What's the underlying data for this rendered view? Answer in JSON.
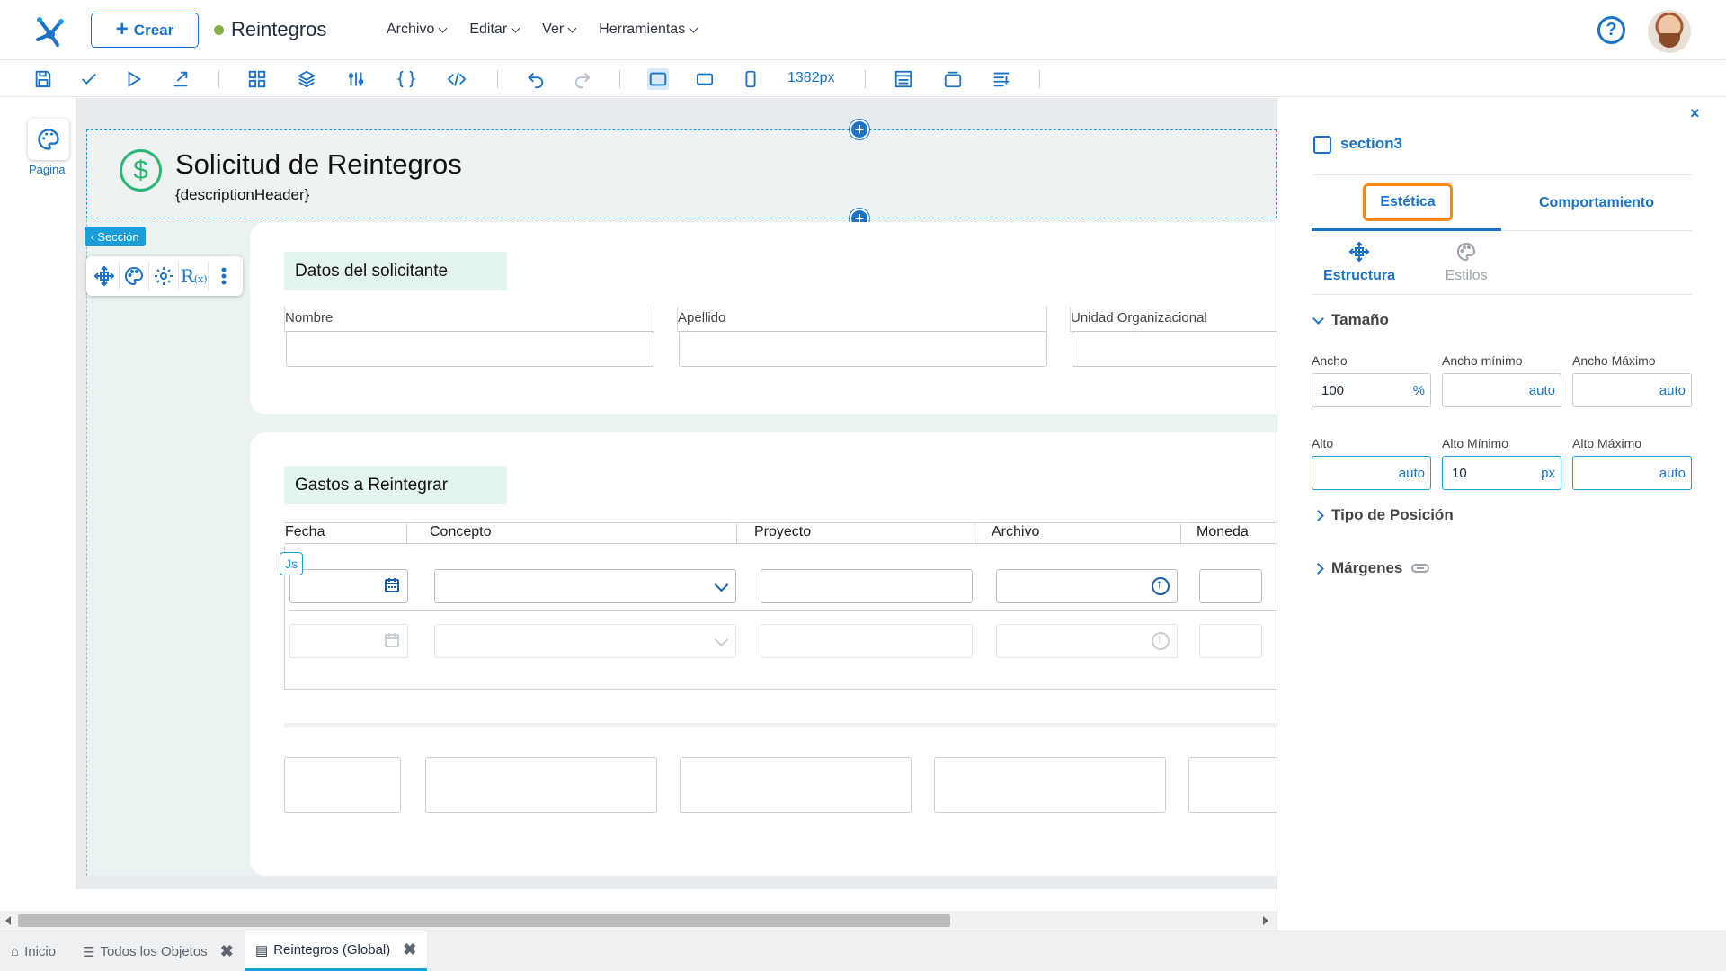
{
  "app": {
    "create_label": "Crear",
    "doc_title": "Reintegros",
    "status_color": "#7cb342"
  },
  "menus": [
    "Archivo",
    "Editar",
    "Ver",
    "Herramientas"
  ],
  "toolbar": {
    "width_readout": "1382px",
    "icons": [
      "save-icon",
      "check-icon",
      "play-icon",
      "export-icon",
      "blocks-icon",
      "layers-icon",
      "variables-icon",
      "braces-icon",
      "code-icon",
      "undo-icon",
      "redo-icon",
      "desktop-view-icon",
      "tablet-view-icon",
      "mobile-view-icon",
      "layout-header-icon",
      "window-icon",
      "align-icon"
    ]
  },
  "left_rail": {
    "pagina_label": "Página"
  },
  "form": {
    "header_title": "Solicitud de Reintegros",
    "header_description": "{descriptionHeader}",
    "section_tag": "Sección",
    "section1": {
      "title": "Datos del solicitante",
      "fields": [
        "Nombre",
        "Apellido",
        "Unidad Organizacional"
      ]
    },
    "section2": {
      "title": "Gastos a Reintegrar",
      "columns": [
        "Fecha",
        "Concepto",
        "Proyecto",
        "Archivo",
        "Moneda"
      ],
      "js_badge": "Js"
    }
  },
  "panel": {
    "section_name": "section3",
    "tabs": [
      "Estética",
      "Comportamiento"
    ],
    "subtabs": [
      "Estructura",
      "Estilos"
    ],
    "size_group": "Tamaño",
    "props": {
      "ancho": {
        "label": "Ancho",
        "value": "100",
        "unit": "%"
      },
      "ancho_min": {
        "label": "Ancho mínimo",
        "value": "auto"
      },
      "ancho_max": {
        "label": "Ancho Máximo",
        "value": "auto"
      },
      "alto": {
        "label": "Alto",
        "value": "auto"
      },
      "alto_min": {
        "label": "Alto Mínimo",
        "value": "10",
        "unit": "px"
      },
      "alto_max": {
        "label": "Alto Máximo",
        "value": "auto"
      }
    },
    "tipo_posicion": "Tipo de Posición",
    "margenes": "Márgenes",
    "highlight_color": "#f08a1a"
  },
  "bottom_tabs": [
    {
      "label": "Inicio"
    },
    {
      "label": "Todos los Objetos"
    },
    {
      "label": "Reintegros (Global)"
    }
  ]
}
